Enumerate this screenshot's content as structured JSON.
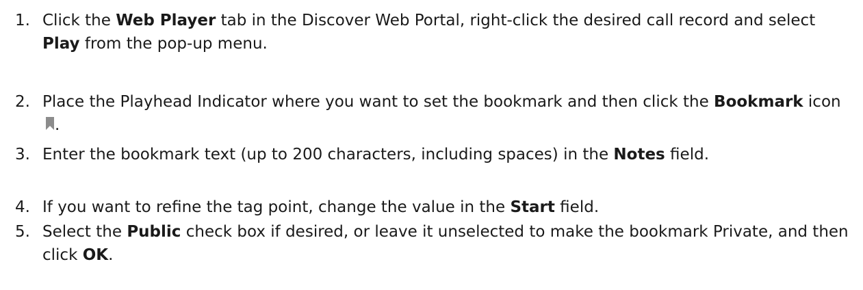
{
  "steps": [
    {
      "number": "1.",
      "parts": [
        {
          "t": "Click the ",
          "b": false
        },
        {
          "t": "Web Player",
          "b": true
        },
        {
          "t": " tab in the Discover Web Portal, right-click the desired call record and select ",
          "b": false
        },
        {
          "t": "Play",
          "b": true
        },
        {
          "t": " from the pop-up menu.",
          "b": false
        }
      ]
    },
    {
      "number": "2.",
      "parts": [
        {
          "t": "Place the Playhead Indicator where you want to set the bookmark and then click the ",
          "b": false
        },
        {
          "t": "Bookmark",
          "b": true
        },
        {
          "t": " icon ",
          "b": false
        },
        {
          "icon": "bookmark-icon"
        },
        {
          "t": ".",
          "b": false
        }
      ]
    },
    {
      "number": "3.",
      "parts": [
        {
          "t": "Enter the bookmark text (up to 200 characters, including spaces) in the ",
          "b": false
        },
        {
          "t": "Notes",
          "b": true
        },
        {
          "t": " field.",
          "b": false
        }
      ]
    },
    {
      "number": "4.",
      "parts": [
        {
          "t": "If you want to refine the tag point, change the value in the ",
          "b": false
        },
        {
          "t": "Start",
          "b": true
        },
        {
          "t": " field.",
          "b": false
        }
      ]
    },
    {
      "number": "5.",
      "parts": [
        {
          "t": "Select the ",
          "b": false
        },
        {
          "t": "Public",
          "b": true
        },
        {
          "t": " check box if desired, or leave it unselected to make the bookmark Private, and then click ",
          "b": false
        },
        {
          "t": "OK",
          "b": true
        },
        {
          "t": ".",
          "b": false
        }
      ]
    }
  ],
  "icons": {
    "bookmark_color": "#8c8c8c"
  }
}
